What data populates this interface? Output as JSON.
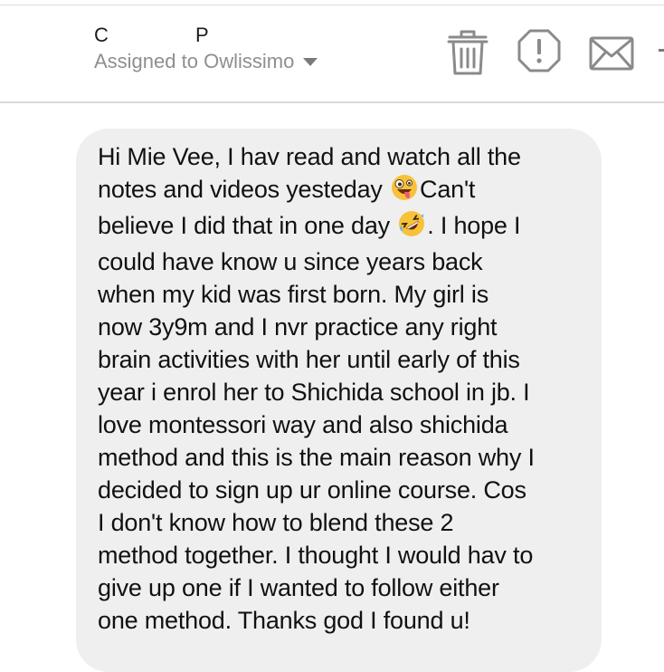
{
  "header": {
    "initials": [
      "C",
      "P"
    ],
    "assigned_text": "Assigned to Owlissimo",
    "icons": [
      "trash-icon",
      "report-spam-icon",
      "mail-icon"
    ],
    "colors": {
      "text": "#1c1c1c",
      "muted": "#8e8e93",
      "icon": "#8a8a8a",
      "bubble": "#efefef"
    }
  },
  "message": {
    "part1": "Hi Mie Vee, I hav read and watch all the\nnotes and videos yesteday ",
    "emoji1": "zany-face",
    "part2": "Can't\nbelieve I did that in one day ",
    "emoji2": "rolling-on-floor-laughing",
    "part3": ". I hope I\ncould have know u since years back\nwhen my kid was first born. My girl is\nnow 3y9m and I nvr practice any right\nbrain activities with her until early of this\nyear i enrol her to Shichida school in jb. I\nlove montessori way and also shichida\nmethod and this is the main reason why I\ndecided to sign up ur online course. Cos\nI don't know how to blend these 2\nmethod together. I thought I would hav to\ngive up one if I wanted to follow either\none method. Thanks god I found u!"
  }
}
